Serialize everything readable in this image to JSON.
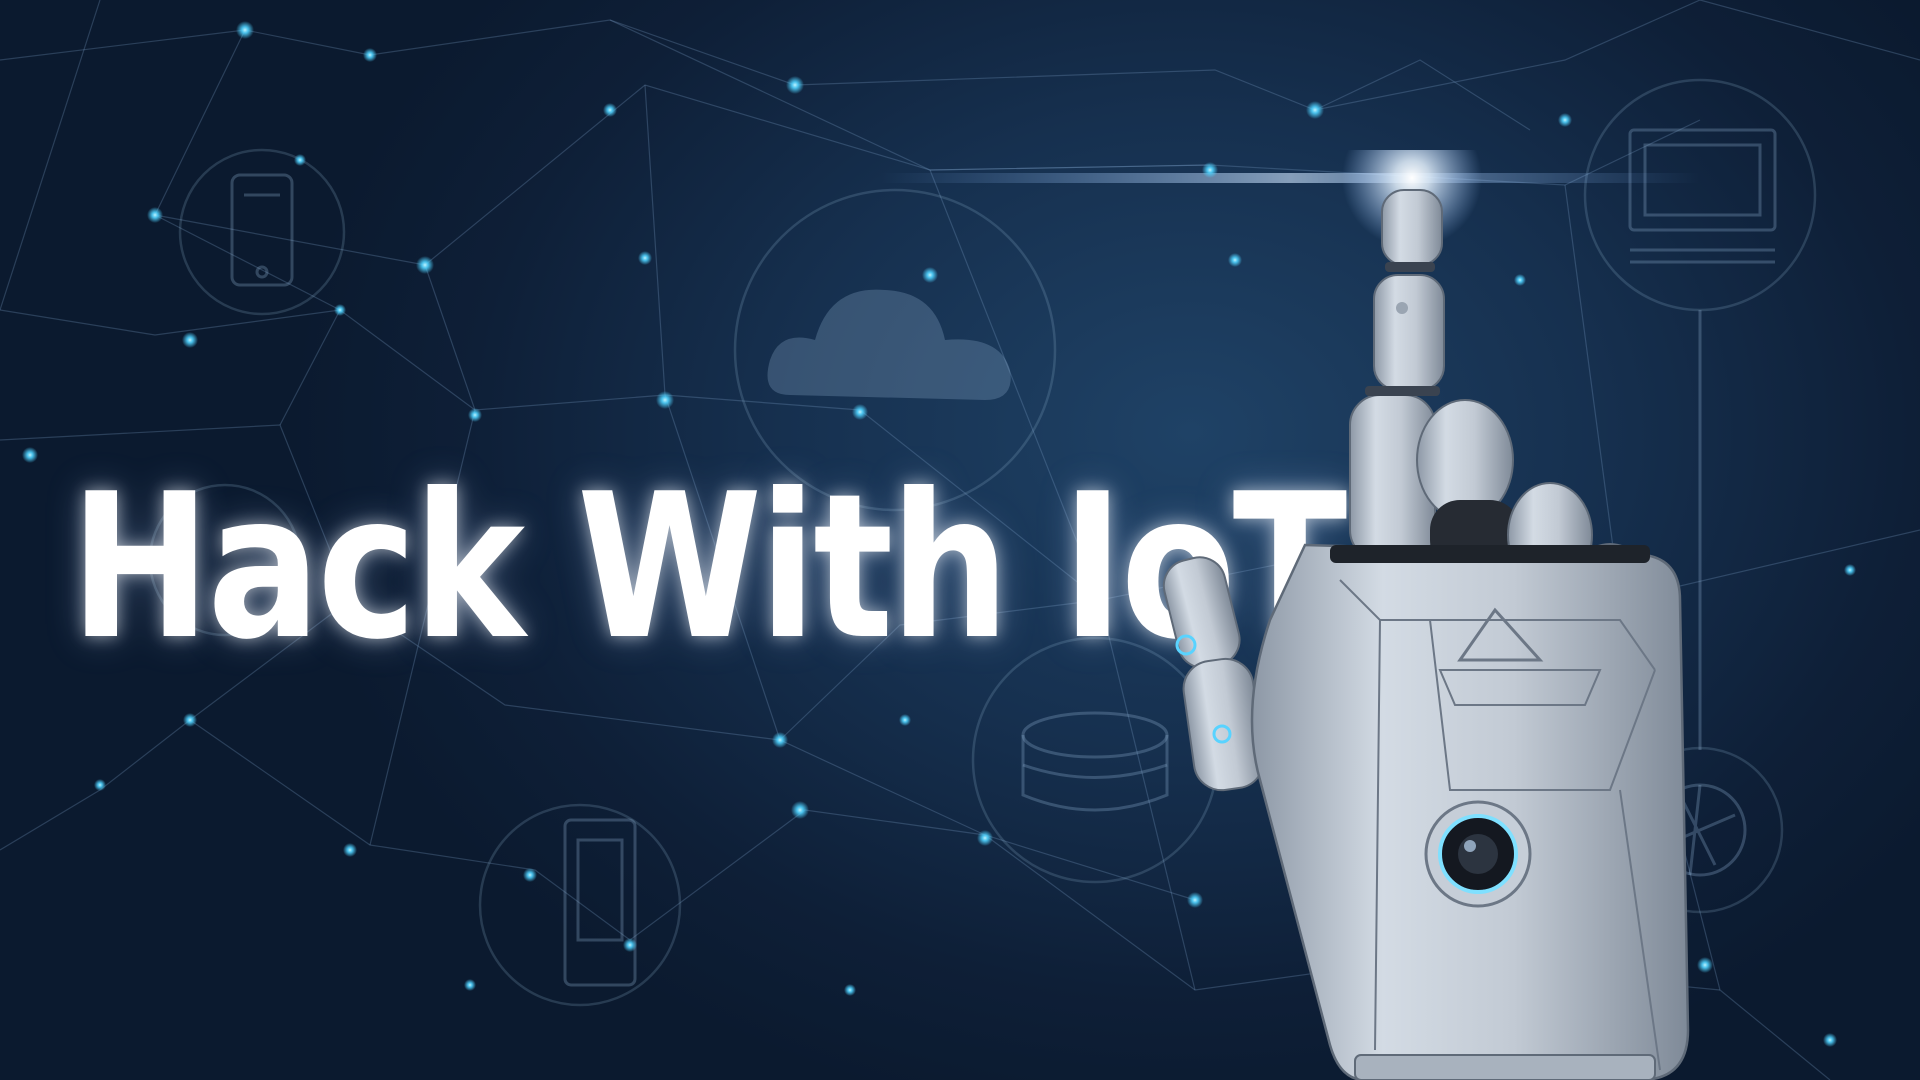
{
  "headline": "Hack With IoT",
  "colors": {
    "background_dark": "#0e1f37",
    "background_mid": "#1f4266",
    "network_node": "#4fd2ff",
    "headline_text": "#ffffff",
    "robot_metal": "#c9d2dd"
  },
  "icons": [
    "smartphone-icon",
    "cloud-icon",
    "monitor-icon",
    "database-icon",
    "phone-icon",
    "aperture-icon"
  ]
}
